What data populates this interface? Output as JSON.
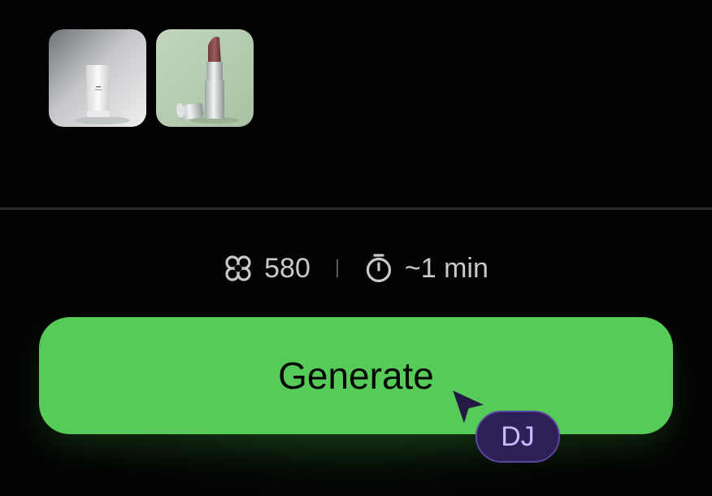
{
  "thumbnails": [
    {
      "icon": "cream-tube-image"
    },
    {
      "icon": "lipstick-image"
    }
  ],
  "meta": {
    "credits_icon": "credits-icon",
    "credits": "580",
    "time_icon": "stopwatch-icon",
    "time": "~1 min"
  },
  "actions": {
    "generate_label": "Generate"
  },
  "collaborator": {
    "initials": "DJ"
  },
  "colors": {
    "background": "#030303",
    "accent": "#56cb57",
    "badge_bg": "#2e1f57",
    "badge_text": "#c8b8ff"
  }
}
